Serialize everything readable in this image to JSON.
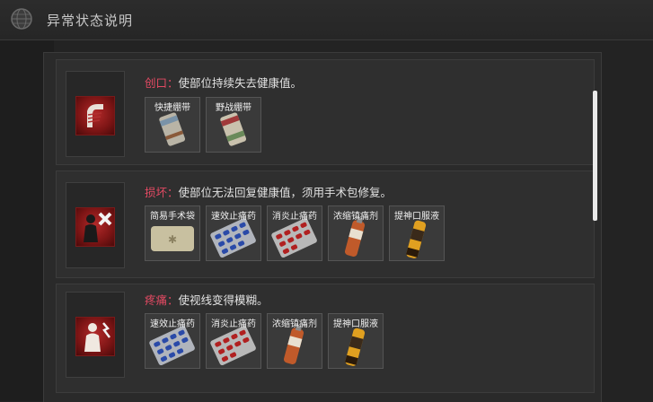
{
  "header": {
    "title": "异常状态说明"
  },
  "statuses": [
    {
      "name": "创口",
      "colon": "：",
      "desc": "使部位持续失去健康值。",
      "items": [
        {
          "label": "快捷绷带",
          "icon": "bandage-icon"
        },
        {
          "label": "野战绷带",
          "icon": "field-bandage-icon"
        }
      ]
    },
    {
      "name": "损坏",
      "colon": "：",
      "desc": "使部位无法回复健康值，须用手术包修复。",
      "items": [
        {
          "label": "简易手术袋",
          "icon": "surgery-bag-icon"
        },
        {
          "label": "速效止痛药",
          "icon": "blue-pill-pack-icon"
        },
        {
          "label": "消炎止痛药",
          "icon": "red-pill-pack-icon"
        },
        {
          "label": "浓缩镇痛剂",
          "icon": "painkiller-injector-icon"
        },
        {
          "label": "提神口服液",
          "icon": "oral-liquid-icon"
        }
      ]
    },
    {
      "name": "疼痛",
      "colon": "：",
      "desc": "使视线变得模糊。",
      "items": [
        {
          "label": "速效止痛药",
          "icon": "blue-pill-pack-icon"
        },
        {
          "label": "消炎止痛药",
          "icon": "red-pill-pack-icon"
        },
        {
          "label": "浓缩镇痛剂",
          "icon": "painkiller-injector-icon"
        },
        {
          "label": "提神口服液",
          "icon": "oral-liquid-icon"
        }
      ]
    }
  ],
  "colors": {
    "status_name": "#e44a63",
    "accent_red": "#a82222"
  }
}
